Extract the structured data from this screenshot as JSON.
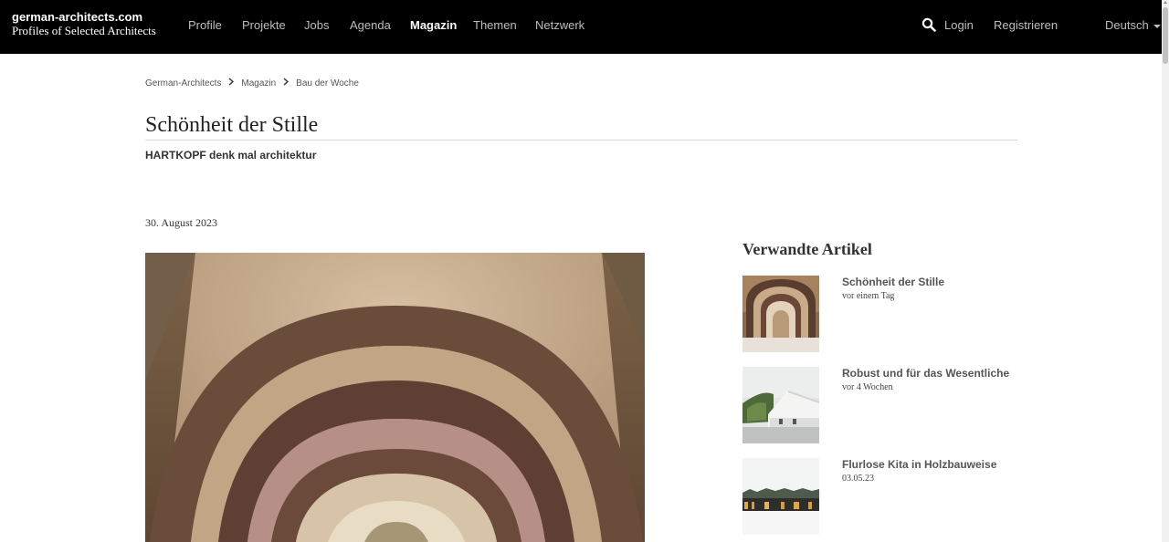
{
  "header": {
    "brand_line1": "german-architects.com",
    "brand_line2": "Profiles of Selected Architects",
    "nav": [
      "Profile",
      "Projekte",
      "Jobs",
      "Agenda",
      "Magazin",
      "Themen",
      "Netzwerk"
    ],
    "active_nav": "Magazin",
    "login": "Login",
    "register": "Registrieren",
    "language": "Deutsch"
  },
  "breadcrumb": [
    "German-Architects",
    "Magazin",
    "Bau der Woche"
  ],
  "article": {
    "title": "Schönheit der Stille",
    "subtitle": "HARTKOPF denk mal architektur",
    "date": "30. August 2023"
  },
  "related": {
    "heading": "Verwandte Artikel",
    "items": [
      {
        "title": "Schönheit der Stille",
        "meta": "vor einem Tag"
      },
      {
        "title": "Robust und für das Wesentliche",
        "meta": "vor 4 Wochen"
      },
      {
        "title": "Flurlose Kita in Holzbauweise",
        "meta": "03.05.23"
      }
    ]
  },
  "colors": {
    "navbar": "#000000",
    "nav_text": "#bdbdbd",
    "nav_active": "#ffffff"
  }
}
